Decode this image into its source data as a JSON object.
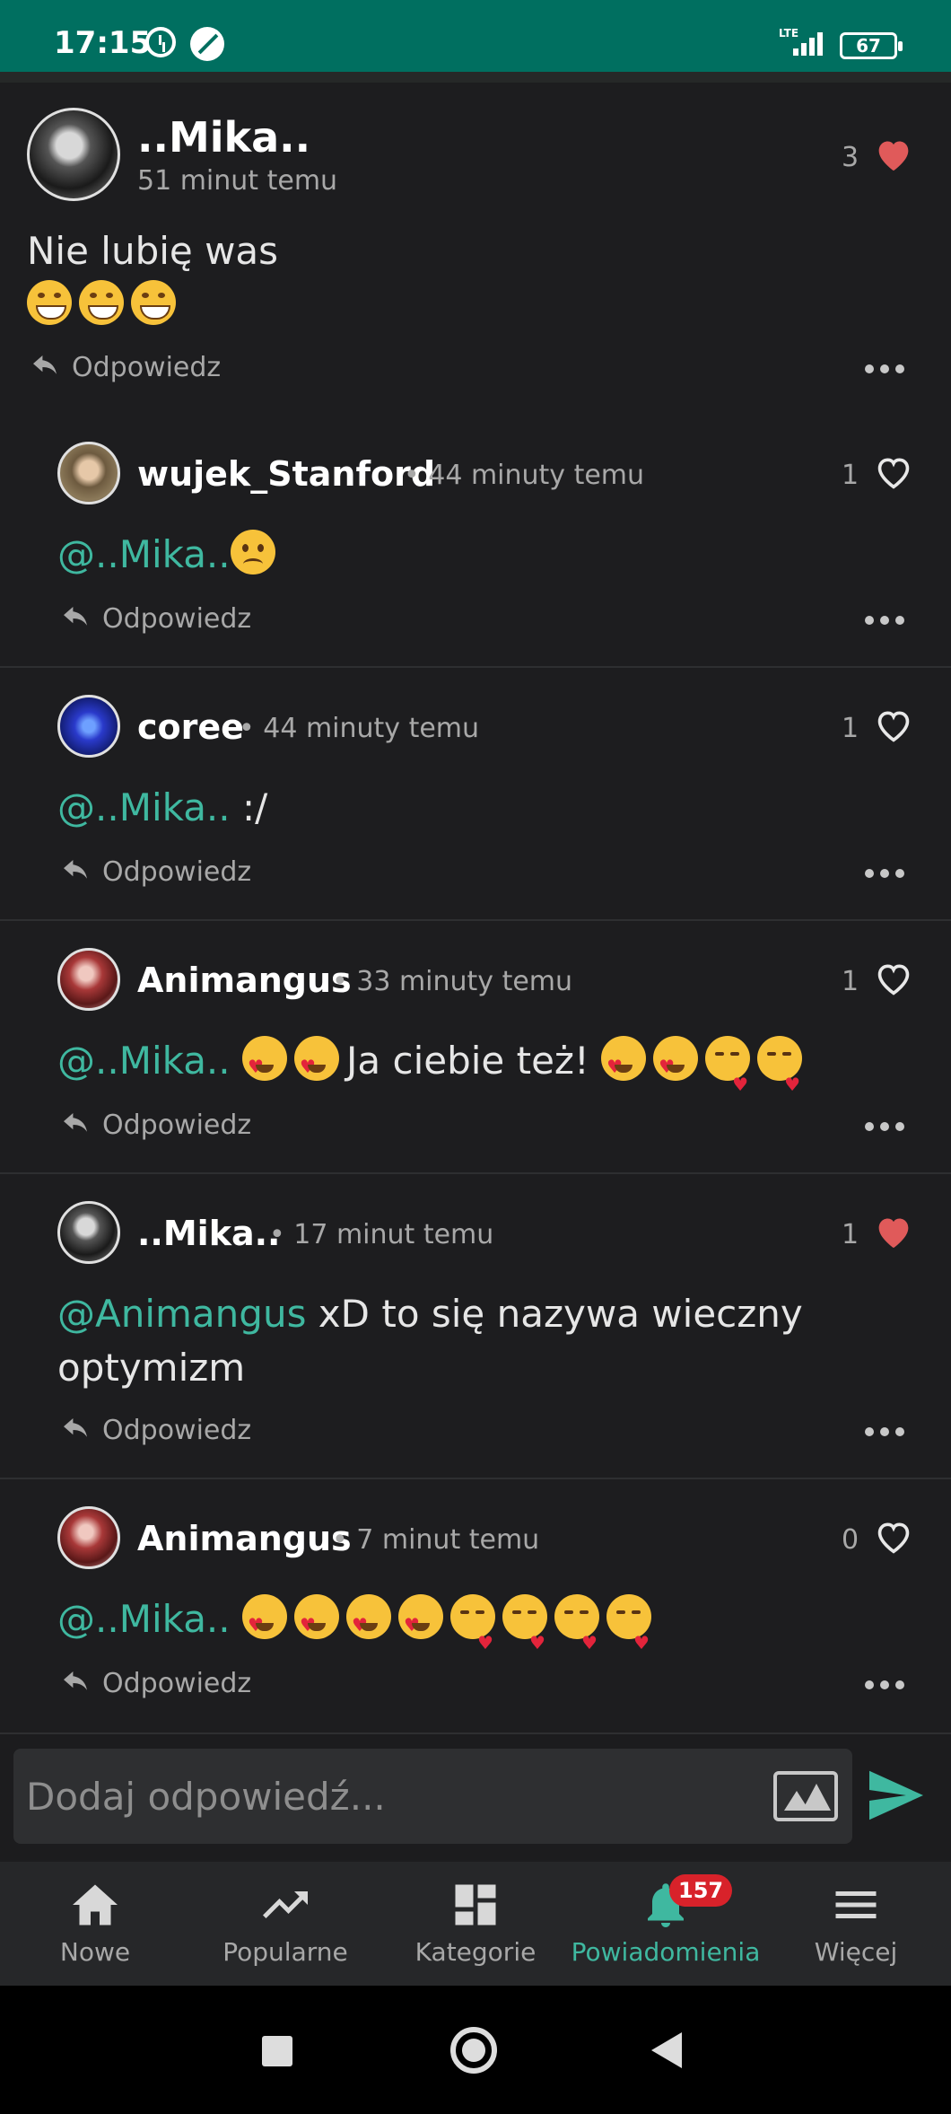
{
  "status_bar": {
    "time": "17:15",
    "network": "LTE",
    "battery": "67",
    "icons": [
      "alarm-icon",
      "leaf-icon",
      "signal-icon",
      "battery-icon"
    ]
  },
  "colors": {
    "accent": "#3fb8a0",
    "status_bar": "#006f60",
    "heart_liked": "#e05a5a",
    "badge": "#d8222a",
    "background": "#1d1d1f"
  },
  "main_comment": {
    "author": "..Mika..",
    "time": "51 minut temu",
    "likes": "3",
    "liked": true,
    "text_line1": "Nie lubię was",
    "emojis": [
      "grin",
      "grin",
      "grin"
    ],
    "reply_label": "Odpowiedz"
  },
  "replies": [
    {
      "author": "wujek_Stanford",
      "time": "• 44 minuty temu",
      "likes": "1",
      "liked": false,
      "mention": "@..Mika..",
      "text": "",
      "emojis": [
        "sad"
      ],
      "reply_label": "Odpowiedz"
    },
    {
      "author": "coree",
      "time": "• 44 minuty temu",
      "likes": "1",
      "liked": false,
      "mention": "@..Mika..",
      "text": " :/",
      "emojis": [],
      "reply_label": "Odpowiedz"
    },
    {
      "author": "Animangus",
      "time": "• 33 minuty temu",
      "likes": "1",
      "liked": false,
      "mention": "@..Mika..",
      "text": "Ja ciebie też!",
      "emojis_before": [
        "love",
        "love"
      ],
      "emojis_after": [
        "love",
        "love",
        "kiss",
        "kiss"
      ],
      "reply_label": "Odpowiedz"
    },
    {
      "author": "..Mika..",
      "time": "• 17 minut temu",
      "likes": "1",
      "liked": true,
      "mention": "@Animangus",
      "text": " xD to się nazywa wieczny",
      "text_line2": "optymizm",
      "reply_label": "Odpowiedz"
    },
    {
      "author": "Animangus",
      "time": "• 7 minut temu",
      "likes": "0",
      "liked": false,
      "mention": "@..Mika..",
      "emojis": [
        "love",
        "love",
        "love",
        "love",
        "kiss",
        "kiss",
        "kiss",
        "kiss"
      ],
      "reply_label": "Odpowiedz"
    }
  ],
  "composer": {
    "placeholder": "Dodaj odpowiedź..."
  },
  "bottom_nav": [
    {
      "label": "Nowe",
      "icon": "home-icon",
      "active": false
    },
    {
      "label": "Popularne",
      "icon": "trending-icon",
      "active": false
    },
    {
      "label": "Kategorie",
      "icon": "grid-icon",
      "active": false
    },
    {
      "label": "Powiadomienia",
      "icon": "bell-icon",
      "active": true,
      "badge": "157"
    },
    {
      "label": "Więcej",
      "icon": "menu-icon",
      "active": false
    }
  ]
}
